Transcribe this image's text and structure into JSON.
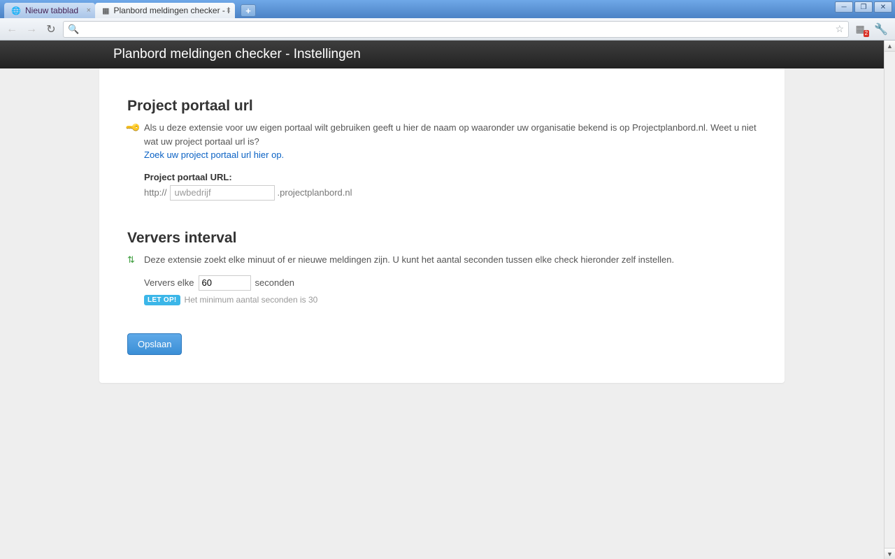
{
  "browser": {
    "tabs": [
      {
        "title": "Nieuw tabblad",
        "active": false
      },
      {
        "title": "Planbord meldingen checker - I",
        "active": true
      }
    ],
    "ext_badge": "2"
  },
  "header": {
    "title": "Planbord meldingen checker - Instellingen"
  },
  "section1": {
    "heading": "Project portaal url",
    "description": "Als u deze extensie voor uw eigen portaal wilt gebruiken geeft u hier de naam op waaronder uw organisatie bekend is op Projectplanbord.nl. Weet u niet wat uw project portaal url is?",
    "link": "Zoek uw project portaal url hier op.",
    "field_label": "Project portaal URL:",
    "prefix": "http://",
    "placeholder": "uwbedrijf",
    "suffix": ".projectplanbord.nl"
  },
  "section2": {
    "heading": "Ververs interval",
    "description": "Deze extensie zoekt elke minuut of er nieuwe meldingen zijn. U kunt het aantal seconden tussen elke check hieronder zelf instellen.",
    "refresh_prefix": "Ververs elke",
    "refresh_value": "60",
    "refresh_suffix": "seconden",
    "badge": "LET OP!",
    "hint": "Het minimum aantal seconden is 30"
  },
  "save_button": "Opslaan"
}
